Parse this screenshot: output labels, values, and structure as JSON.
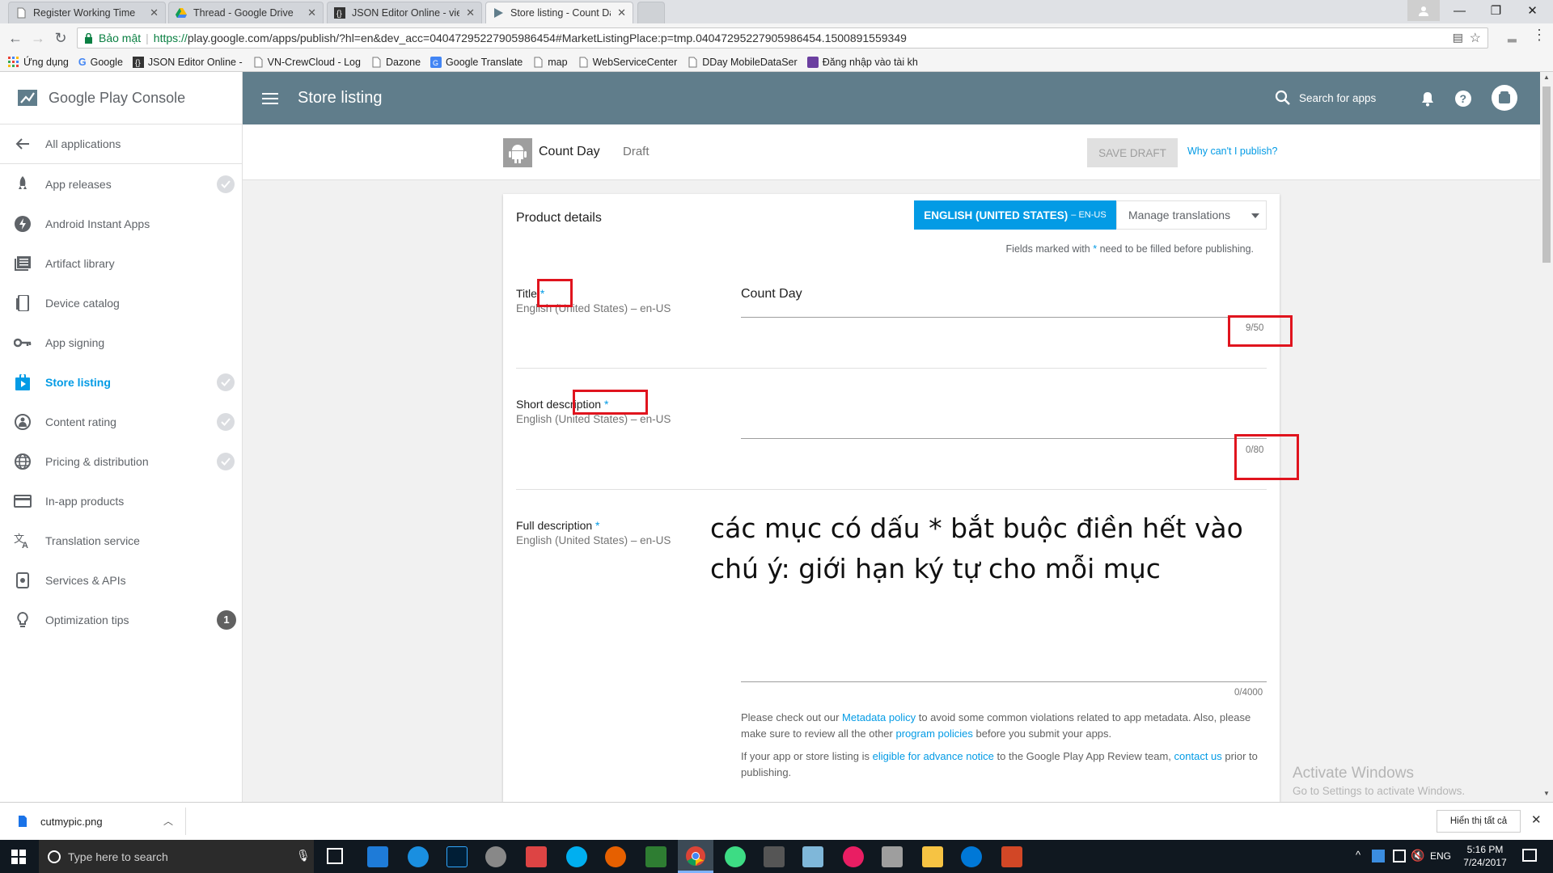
{
  "browser": {
    "tabs": [
      {
        "title": "Register Working Time"
      },
      {
        "title": "Thread - Google Drive"
      },
      {
        "title": "JSON Editor Online - vie"
      },
      {
        "title": "Store listing - Count Day"
      }
    ],
    "secure_label": "Bảo mật",
    "url_proto": "https://",
    "url_rest": "play.google.com/apps/publish/?hl=en&dev_acc=04047295227905986454#MarketListingPlace:p=tmp.04047295227905986454.1500891559349",
    "bookmarks": [
      "Ứng dụng",
      "Google",
      "JSON Editor Online -",
      "VN-CrewCloud - Log",
      "Dazone",
      "Google Translate",
      "map",
      "WebServiceCenter",
      "DDay MobileDataSer",
      "Đăng nhập vào tài kh"
    ]
  },
  "console": {
    "logo": "Google Play Console",
    "page_title": "Store listing",
    "search_label": "Search for apps"
  },
  "sidebar": {
    "items": [
      {
        "label": "All applications",
        "icon": "arrow-left-icon"
      },
      {
        "label": "App releases",
        "icon": "rocket-icon",
        "check": true
      },
      {
        "label": "Android Instant Apps",
        "icon": "bolt-icon"
      },
      {
        "label": "Artifact library",
        "icon": "library-icon"
      },
      {
        "label": "Device catalog",
        "icon": "device-icon"
      },
      {
        "label": "App signing",
        "icon": "key-icon"
      },
      {
        "label": "Store listing",
        "icon": "store-icon",
        "check": true,
        "active": true
      },
      {
        "label": "Content rating",
        "icon": "rating-icon",
        "check": true
      },
      {
        "label": "Pricing & distribution",
        "icon": "globe-icon",
        "check": true
      },
      {
        "label": "In-app products",
        "icon": "card-icon"
      },
      {
        "label": "Translation service",
        "icon": "translate-icon"
      },
      {
        "label": "Services & APIs",
        "icon": "api-icon"
      },
      {
        "label": "Optimization tips",
        "icon": "bulb-icon",
        "badge": "1"
      }
    ]
  },
  "app": {
    "name": "Count Day",
    "status": "Draft",
    "save_draft": "SAVE DRAFT",
    "why_link": "Why can't I publish?"
  },
  "card": {
    "section_title": "Product details",
    "language_button": "ENGLISH (UNITED STATES)",
    "language_code": "– EN-US",
    "manage_translations": "Manage translations",
    "required_note_pre": "Fields marked with",
    "required_note_star": "*",
    "required_note_post": "need to be filled before publishing.",
    "fields": {
      "title": {
        "label": "Title",
        "lang": "English (United States) – en-US",
        "value": "Count Day",
        "counter": "9/50"
      },
      "short": {
        "label": "Short description",
        "lang": "English (United States) – en-US",
        "value": "",
        "counter": "0/80"
      },
      "full": {
        "label": "Full description",
        "lang": "English (United States) – en-US",
        "value": "",
        "counter": "0/4000"
      }
    },
    "policy_1": "Please check out our",
    "policy_link1": "Metadata policy",
    "policy_2": "to avoid some common violations related to app metadata. Also, please make sure to review all the other",
    "policy_link2": "program policies",
    "policy_3": "before you submit your apps.",
    "notice_1": "If your app or store listing is",
    "notice_link1": "eligible for advance notice",
    "notice_2": "to the Google Play App Review team,",
    "notice_link2": "contact us",
    "notice_3": "prior to publishing."
  },
  "annotation": {
    "line1": "các mục có dấu * bắt buộc điền hết vào",
    "line2": "chú ý: giới hạn ký tự cho mỗi mục"
  },
  "watermark": {
    "title": "Activate Windows",
    "sub": "Go to Settings to activate Windows."
  },
  "downloads": {
    "file": "cutmypic.png",
    "show_all": "Hiển thị tất cả"
  },
  "taskbar": {
    "search_placeholder": "Type here to search",
    "lang": "ENG",
    "time": "5:16 PM",
    "date": "7/24/2017"
  },
  "colors": {
    "header": "#607d8b",
    "accent": "#039be5",
    "annotation_box": "#e0141e"
  }
}
